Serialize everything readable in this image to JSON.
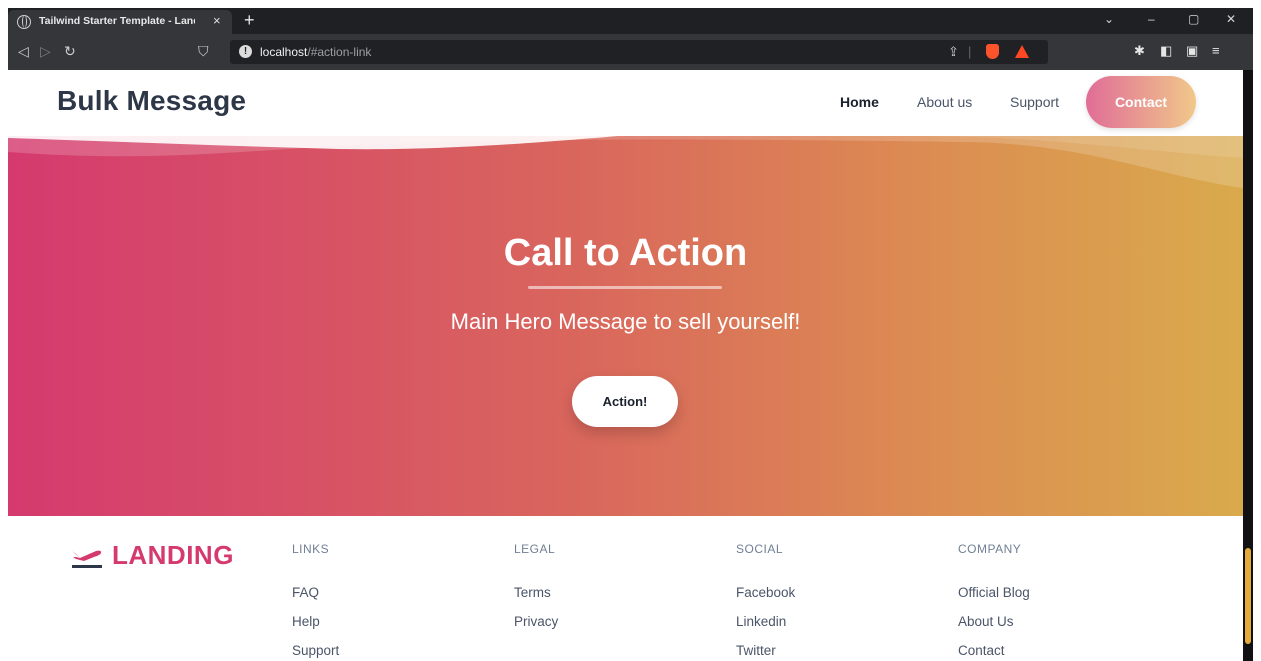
{
  "browser": {
    "tab_title": "Tailwind Starter Template - Landing",
    "close_glyph": "×",
    "new_tab_glyph": "+",
    "url_host": "localhost",
    "url_path": "/#action-link",
    "info_glyph": "!"
  },
  "header": {
    "logo": "Bulk Message",
    "nav": [
      {
        "label": "Home",
        "active": true
      },
      {
        "label": "About us",
        "active": false
      },
      {
        "label": "Support",
        "active": false
      }
    ],
    "contact_label": "Contact"
  },
  "hero": {
    "title": "Call to Action",
    "subtitle": "Main Hero Message to sell yourself!",
    "action_label": "Action!"
  },
  "footer": {
    "logo": "LANDING",
    "columns": [
      {
        "heading": "LINKS",
        "links": [
          "FAQ",
          "Help",
          "Support"
        ]
      },
      {
        "heading": "LEGAL",
        "links": [
          "Terms",
          "Privacy"
        ]
      },
      {
        "heading": "SOCIAL",
        "links": [
          "Facebook",
          "Linkedin",
          "Twitter"
        ]
      },
      {
        "heading": "COMPANY",
        "links": [
          "Official Blog",
          "About Us",
          "Contact"
        ]
      }
    ]
  },
  "colors": {
    "brand_pink": "#d53a6f",
    "brand_gold": "#d9aa4c",
    "chrome_dark": "#35363a",
    "scroll_thumb": "#e4ab3c"
  }
}
